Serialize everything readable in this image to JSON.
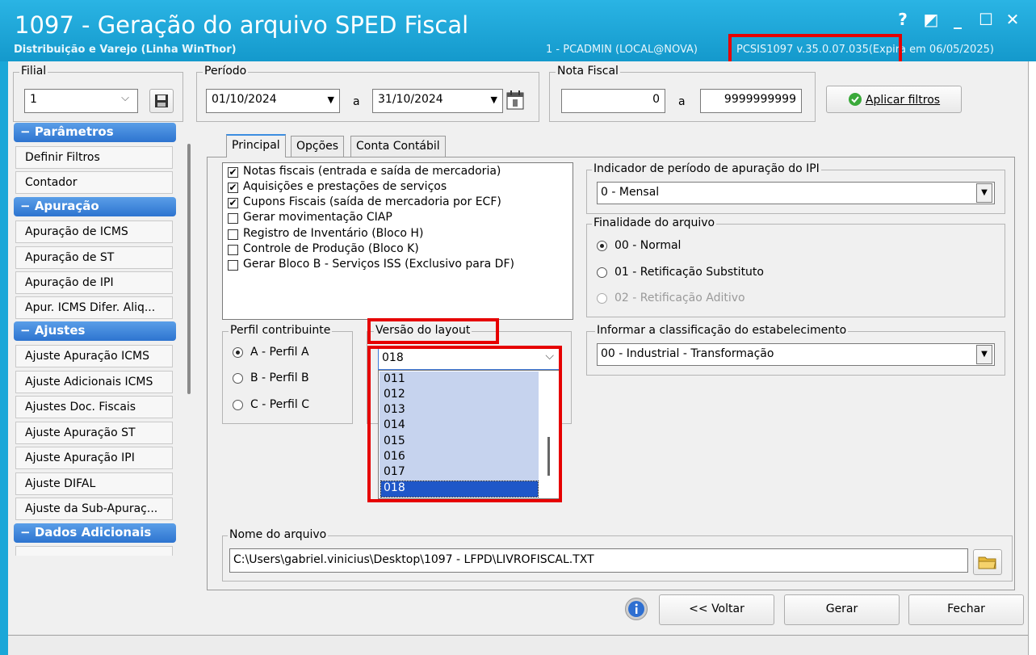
{
  "window": {
    "title": "1097 - Geração do arquivo SPED Fiscal",
    "subtitle": "Distribuição e Varejo (Linha WinThor)",
    "user_info": "1 - PCADMIN (LOCAL@NOVA)",
    "version_info": "PCSIS1097  v.35.0.07.035(Expira em 06/05/2025)",
    "help_glyph": "?",
    "restore_glyph": "◩",
    "minimize_glyph": "_",
    "maximize_glyph": "☐",
    "close_glyph": "✕"
  },
  "filial": {
    "legend": "Filial",
    "value": "1",
    "save_icon": "floppy-disk-icon"
  },
  "periodo": {
    "legend": "Período",
    "start": "01/10/2024",
    "sep": "a",
    "end": "31/10/2024",
    "calendar_icon": "calendar-icon"
  },
  "nota_fiscal": {
    "legend": "Nota Fiscal",
    "start": "0",
    "sep": "a",
    "end": "9999999999"
  },
  "apply_button": {
    "label": "Aplicar filtros",
    "icon": "check-circle-icon"
  },
  "sidebar": {
    "categories": [
      {
        "label": "Parâmetros",
        "items": [
          "Definir Filtros",
          "Contador"
        ]
      },
      {
        "label": "Apuração",
        "items": [
          "Apuração de ICMS",
          "Apuração de ST",
          "Apuração de IPI",
          "Apur. ICMS Difer. Aliq..."
        ]
      },
      {
        "label": "Ajustes",
        "items": [
          "Ajuste Apuração ICMS",
          "Ajuste Adicionais ICMS",
          "Ajustes Doc. Fiscais",
          "Ajuste Apuração ST",
          "Ajuste Apuração IPI",
          "Ajuste DIFAL",
          "Ajuste da Sub-Apuraç..."
        ]
      },
      {
        "label": "Dados Adicionais",
        "items": []
      }
    ],
    "category_marker": "−"
  },
  "tabs": [
    "Principal",
    "Opções",
    "Conta Contábil"
  ],
  "checkboxes": [
    {
      "label": "Notas fiscais (entrada e saída de mercadoria)",
      "checked": true
    },
    {
      "label": "Aquisições e prestações de serviços",
      "checked": true
    },
    {
      "label": "Cupons Fiscais (saída de mercadoria por ECF)",
      "checked": true
    },
    {
      "label": "Gerar movimentação CIAP",
      "checked": false
    },
    {
      "label": "Registro de Inventário (Bloco H)",
      "checked": false
    },
    {
      "label": "Controle de Produção (Bloco K)",
      "checked": false
    },
    {
      "label": "Gerar Bloco B - Serviços ISS (Exclusivo para DF)",
      "checked": false
    }
  ],
  "check_glyph": "✔",
  "perfil": {
    "legend": "Perfil contribuinte",
    "options": [
      "A - Perfil A",
      "B - Perfil B",
      "C - Perfil C"
    ],
    "selected": 0
  },
  "versao": {
    "legend": "Versão do layout",
    "value": "018",
    "options": [
      "011",
      "012",
      "013",
      "014",
      "015",
      "016",
      "017",
      "018"
    ],
    "selected": "018"
  },
  "ipi": {
    "legend": "Indicador de período de apuração do IPI",
    "value": "0 - Mensal"
  },
  "finalidade": {
    "legend": "Finalidade do arquivo",
    "options": [
      "00 - Normal",
      "01 - Retificação Substituto",
      "02 - Retificação Aditivo"
    ],
    "selected": 0
  },
  "classificacao": {
    "legend": "Informar a classificação do estabelecimento",
    "value": "00 - Industrial - Transformação"
  },
  "arquivo": {
    "legend": "Nome do arquivo",
    "path": "C:\\Users\\gabriel.vinicius\\Desktop\\1097 - LFPD\\LIVROFISCAL.TXT",
    "folder_icon": "folder-icon"
  },
  "footer": {
    "info_icon": "info-icon",
    "back": "<< Voltar",
    "generate": "Gerar",
    "close": "Fechar"
  },
  "colors": {
    "titlebar": "#1aa7d8",
    "highlight": "#e60000",
    "category": "#2d74d0",
    "list_selected": "#1f57c8"
  }
}
